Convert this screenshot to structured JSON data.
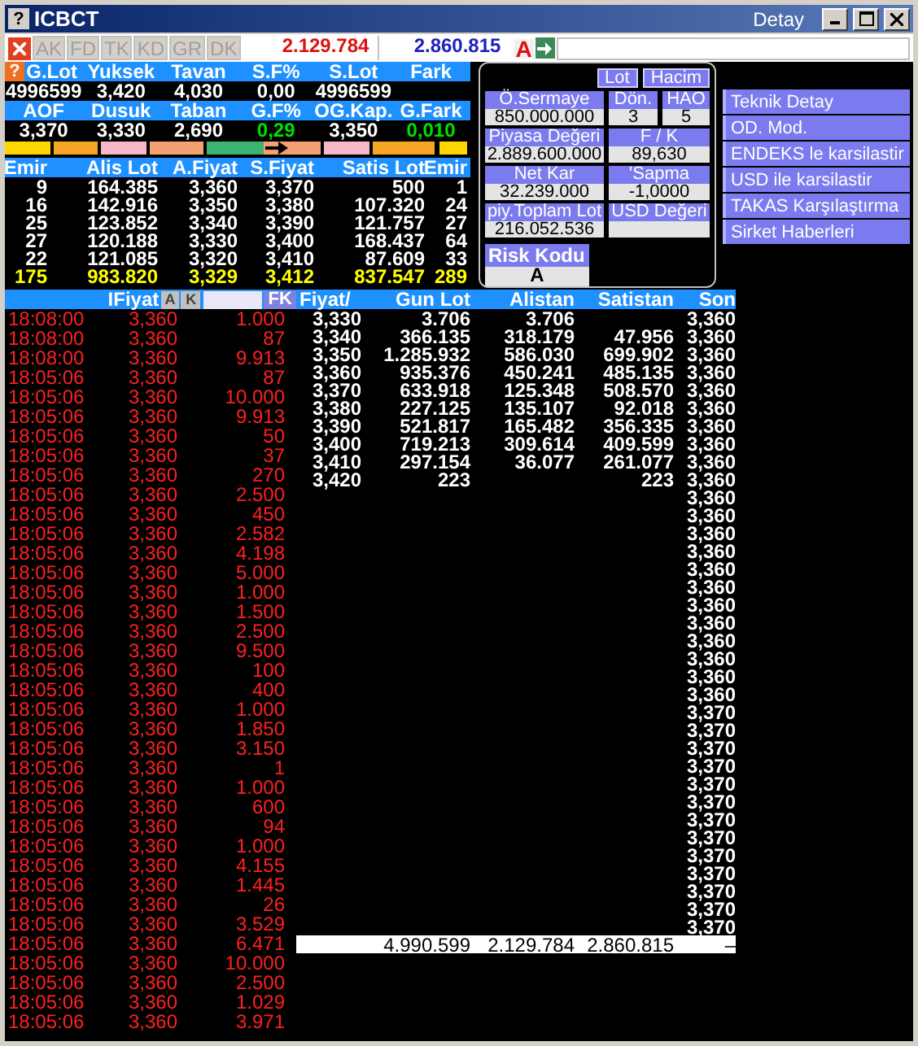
{
  "window": {
    "icon": "?",
    "title": "ICBCT",
    "subtitle": "Detay"
  },
  "toolbar": {
    "buttons": [
      "AK",
      "FD",
      "TK",
      "KD",
      "GR",
      "DK"
    ],
    "buy_volume": "2.129.784",
    "sell_volume": "2.860.815",
    "flag": "A"
  },
  "summary": {
    "help": "?",
    "rows": [
      {
        "headers": [
          "G.Lot",
          "Yuksek",
          "Tavan",
          "S.F%",
          "S.Lot",
          "Fark"
        ],
        "values": [
          {
            "text": "4996599",
            "rising": false
          },
          {
            "text": "3,420",
            "rising": false
          },
          {
            "text": "4,030",
            "rising": false
          },
          {
            "text": "0,00",
            "rising": false
          },
          {
            "text": "4996599",
            "rising": false
          }
        ]
      },
      {
        "headers": [
          "AOF",
          "Dusuk",
          "Taban",
          "G.F%",
          "OG.Kap.",
          "G.Fark"
        ],
        "values": [
          {
            "text": "3,370",
            "rising": false
          },
          {
            "text": "3,330",
            "rising": false
          },
          {
            "text": "2,690",
            "rising": false
          },
          {
            "text": "0,29",
            "rising": true
          },
          {
            "text": "3,350",
            "rising": false
          },
          {
            "text": "0,010",
            "rising": true
          }
        ]
      }
    ]
  },
  "order_book": {
    "columns": [
      "Emir",
      "Alis Lot",
      "A.Fiyat",
      "S.Fiyat",
      "Satis Lot",
      "Emir"
    ],
    "rows": [
      [
        "9",
        "164.385",
        "3,360",
        "3,370",
        "500",
        "1"
      ],
      [
        "16",
        "142.916",
        "3,350",
        "3,380",
        "107.320",
        "24"
      ],
      [
        "25",
        "123.852",
        "3,340",
        "3,390",
        "121.757",
        "27"
      ],
      [
        "27",
        "120.188",
        "3,330",
        "3,400",
        "168.437",
        "64"
      ],
      [
        "22",
        "121.085",
        "3,320",
        "3,410",
        "87.609",
        "33"
      ]
    ],
    "totals": [
      "175",
      "983.820",
      "3,329",
      "3,412",
      "837.547",
      "289"
    ]
  },
  "info_panel": {
    "tabs": [
      "Lot",
      "Hacim"
    ],
    "rows": [
      [
        {
          "label": "Ö.Sermaye",
          "value": "850.000.000"
        },
        {
          "label": "Dön.",
          "value": "3"
        },
        {
          "label": "HAO",
          "value": "5"
        }
      ],
      [
        {
          "label": "Piyasa Değeri",
          "value": "2.889.600.000"
        },
        {
          "label": "F / K",
          "value": "89,630"
        }
      ],
      [
        {
          "label": "Net Kar",
          "value": "32.239.000"
        },
        {
          "label": "'Sapma",
          "value": "-1,0000"
        }
      ],
      [
        {
          "label": "piy.Toplam Lot",
          "value": "216.052.536"
        },
        {
          "label": "USD Değeri"
        }
      ]
    ],
    "risk": {
      "label": "Risk Kodu",
      "value": "A"
    }
  },
  "menu": [
    "Teknik Detay",
    "OD. Mod.",
    "ENDEKS le karsilastir",
    "USD ile karsilastir",
    "TAKAS Karşılaştırma",
    "Sirket Haberleri"
  ],
  "trades": {
    "header": "IFiyat",
    "buttons": [
      "A",
      "K"
    ],
    "filter_button": "FK",
    "rows": [
      [
        "18:08:00",
        "3,360",
        "1.000"
      ],
      [
        "18:08:00",
        "3,360",
        "87"
      ],
      [
        "18:08:00",
        "3,360",
        "9.913"
      ],
      [
        "18:05:06",
        "3,360",
        "87"
      ],
      [
        "18:05:06",
        "3,360",
        "10.000"
      ],
      [
        "18:05:06",
        "3,360",
        "9.913"
      ],
      [
        "18:05:06",
        "3,360",
        "50"
      ],
      [
        "18:05:06",
        "3,360",
        "37"
      ],
      [
        "18:05:06",
        "3,360",
        "270"
      ],
      [
        "18:05:06",
        "3,360",
        "2.500"
      ],
      [
        "18:05:06",
        "3,360",
        "450"
      ],
      [
        "18:05:06",
        "3,360",
        "2.582"
      ],
      [
        "18:05:06",
        "3,360",
        "4.198"
      ],
      [
        "18:05:06",
        "3,360",
        "5.000"
      ],
      [
        "18:05:06",
        "3,360",
        "1.000"
      ],
      [
        "18:05:06",
        "3,360",
        "1.500"
      ],
      [
        "18:05:06",
        "3,360",
        "2.500"
      ],
      [
        "18:05:06",
        "3,360",
        "9.500"
      ],
      [
        "18:05:06",
        "3,360",
        "100"
      ],
      [
        "18:05:06",
        "3,360",
        "400"
      ],
      [
        "18:05:06",
        "3,360",
        "1.000"
      ],
      [
        "18:05:06",
        "3,360",
        "1.850"
      ],
      [
        "18:05:06",
        "3,360",
        "3.150"
      ],
      [
        "18:05:06",
        "3,360",
        "1"
      ],
      [
        "18:05:06",
        "3,360",
        "1.000"
      ],
      [
        "18:05:06",
        "3,360",
        "600"
      ],
      [
        "18:05:06",
        "3,360",
        "94"
      ],
      [
        "18:05:06",
        "3,360",
        "1.000"
      ],
      [
        "18:05:06",
        "3,360",
        "4.155"
      ],
      [
        "18:05:06",
        "3,360",
        "1.445"
      ],
      [
        "18:05:06",
        "3,360",
        "26"
      ],
      [
        "18:05:06",
        "3,360",
        "3.529"
      ],
      [
        "18:05:06",
        "3,360",
        "6.471"
      ],
      [
        "18:05:06",
        "3,360",
        "10.000"
      ],
      [
        "18:05:06",
        "3,360",
        "2.500"
      ],
      [
        "18:05:06",
        "3,360",
        "1.029"
      ],
      [
        "18:05:06",
        "3,360",
        "3.971"
      ]
    ]
  },
  "price_table": {
    "columns": [
      "Fiyat/",
      "Gun Lot",
      "Alistan",
      "Satistan",
      "Son"
    ],
    "rows": [
      [
        "3,330",
        "3.706",
        "3.706",
        ""
      ],
      [
        "3,340",
        "366.135",
        "318.179",
        "47.956"
      ],
      [
        "3,350",
        "1.285.932",
        "586.030",
        "699.902"
      ],
      [
        "3,360",
        "935.376",
        "450.241",
        "485.135"
      ],
      [
        "3,370",
        "633.918",
        "125.348",
        "508.570"
      ],
      [
        "3,380",
        "227.125",
        "135.107",
        "92.018"
      ],
      [
        "3,390",
        "521.817",
        "165.482",
        "356.335"
      ],
      [
        "3,400",
        "719.213",
        "309.614",
        "409.599"
      ],
      [
        "3,410",
        "297.154",
        "36.077",
        "261.077"
      ],
      [
        "3,420",
        "223",
        "",
        "223"
      ]
    ],
    "son": [
      "3,360",
      "3,360",
      "3,360",
      "3,360",
      "3,360",
      "3,360",
      "3,360",
      "3,360",
      "3,360",
      "3,360",
      "3,360",
      "3,360",
      "3,360",
      "3,360",
      "3,360",
      "3,360",
      "3,360",
      "3,360",
      "3,360",
      "3,360",
      "3,360",
      "3,360",
      "3,370",
      "3,370",
      "3,370",
      "3,370",
      "3,370",
      "3,370",
      "3,370",
      "3,370",
      "3,370",
      "3,370",
      "3,370",
      "3,370",
      "3,370"
    ],
    "footer": [
      "4.990.599",
      "2.129.784",
      "2.860.815",
      "–"
    ]
  }
}
